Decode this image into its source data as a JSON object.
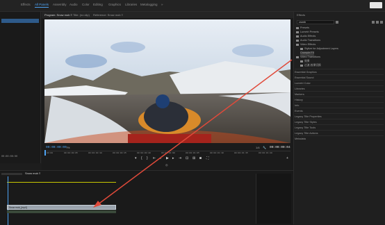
{
  "workspace_tabs": [
    "Effects",
    "All Panels",
    "Assembly",
    "Audio",
    "Color",
    "Editing",
    "Graphics",
    "Libraries",
    "Metalogging",
    "»"
  ],
  "active_workspace": "All Panels",
  "source_panel": {
    "sequence_name": "",
    "timecode_left": "00:00:00:00",
    "timecode_right": "00:00:00:00"
  },
  "program_tabs": [
    "Program: Snow mob ≡",
    "Title: (no clip)",
    "Reference: Snow mob ≡"
  ],
  "program": {
    "timecode": "00:00:00:00",
    "fit": "Fit",
    "quality": "1/4",
    "duration": "00:00:00:04"
  },
  "ruler_labels": [
    "00:00",
    "00:00:00:05",
    "00:00:00:10",
    "00:00:00:15",
    "00:00:00:20",
    "00:00:01:00",
    "00:00:01:05",
    "00:00:01:10",
    "00:00:01:15",
    "00:00:01:20"
  ],
  "effects_panel": {
    "title": "Effects",
    "search_value": "crumb",
    "tree": [
      "Presets",
      "Lumetri Presets",
      "Audio Effects",
      "Audio Transitions",
      "Video Effects",
      "Stylize for Adjustment Layers",
      "Crumple FX",
      "Video Transitions",
      "效果",
      "过渡,效果切换"
    ],
    "categories": [
      "Essential Graphics",
      "Essential Sound",
      "Lumetri Color",
      "Libraries",
      "Markers",
      "History",
      "Info",
      "Events",
      "Legacy Title Properties",
      "Legacy Title Styles",
      "Legacy Title Tools",
      "Legacy Title Actions",
      "Metadata"
    ]
  },
  "timeline": {
    "tab": "Snow mob ≡",
    "clip_label": "Snow mob_[mp4]"
  },
  "colors": {
    "accent": "#4ea4f5",
    "arrow": "#e04a3a",
    "playhead": "#4ea4f5",
    "workarea": "#c8c800"
  }
}
